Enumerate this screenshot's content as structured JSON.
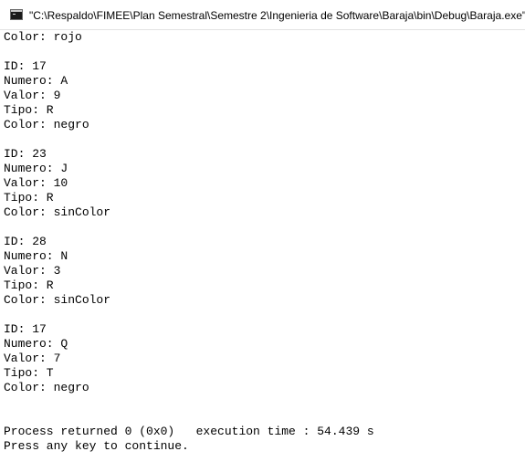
{
  "window": {
    "title": "\"C:\\Respaldo\\FIMEE\\Plan Semestral\\Semestre 2\\Ingenieria de Software\\Baraja\\bin\\Debug\\Baraja.exe\""
  },
  "console": {
    "lines": [
      "Color: rojo",
      "",
      "ID: 17",
      "Numero: A",
      "Valor: 9",
      "Tipo: R",
      "Color: negro",
      "",
      "ID: 23",
      "Numero: J",
      "Valor: 10",
      "Tipo: R",
      "Color: sinColor",
      "",
      "ID: 28",
      "Numero: N",
      "Valor: 3",
      "Tipo: R",
      "Color: sinColor",
      "",
      "ID: 17",
      "Numero: Q",
      "Valor: 7",
      "Tipo: T",
      "Color: negro",
      "",
      "",
      "Process returned 0 (0x0)   execution time : 54.439 s",
      "Press any key to continue."
    ]
  },
  "icons": {
    "app": "console-window-icon"
  }
}
